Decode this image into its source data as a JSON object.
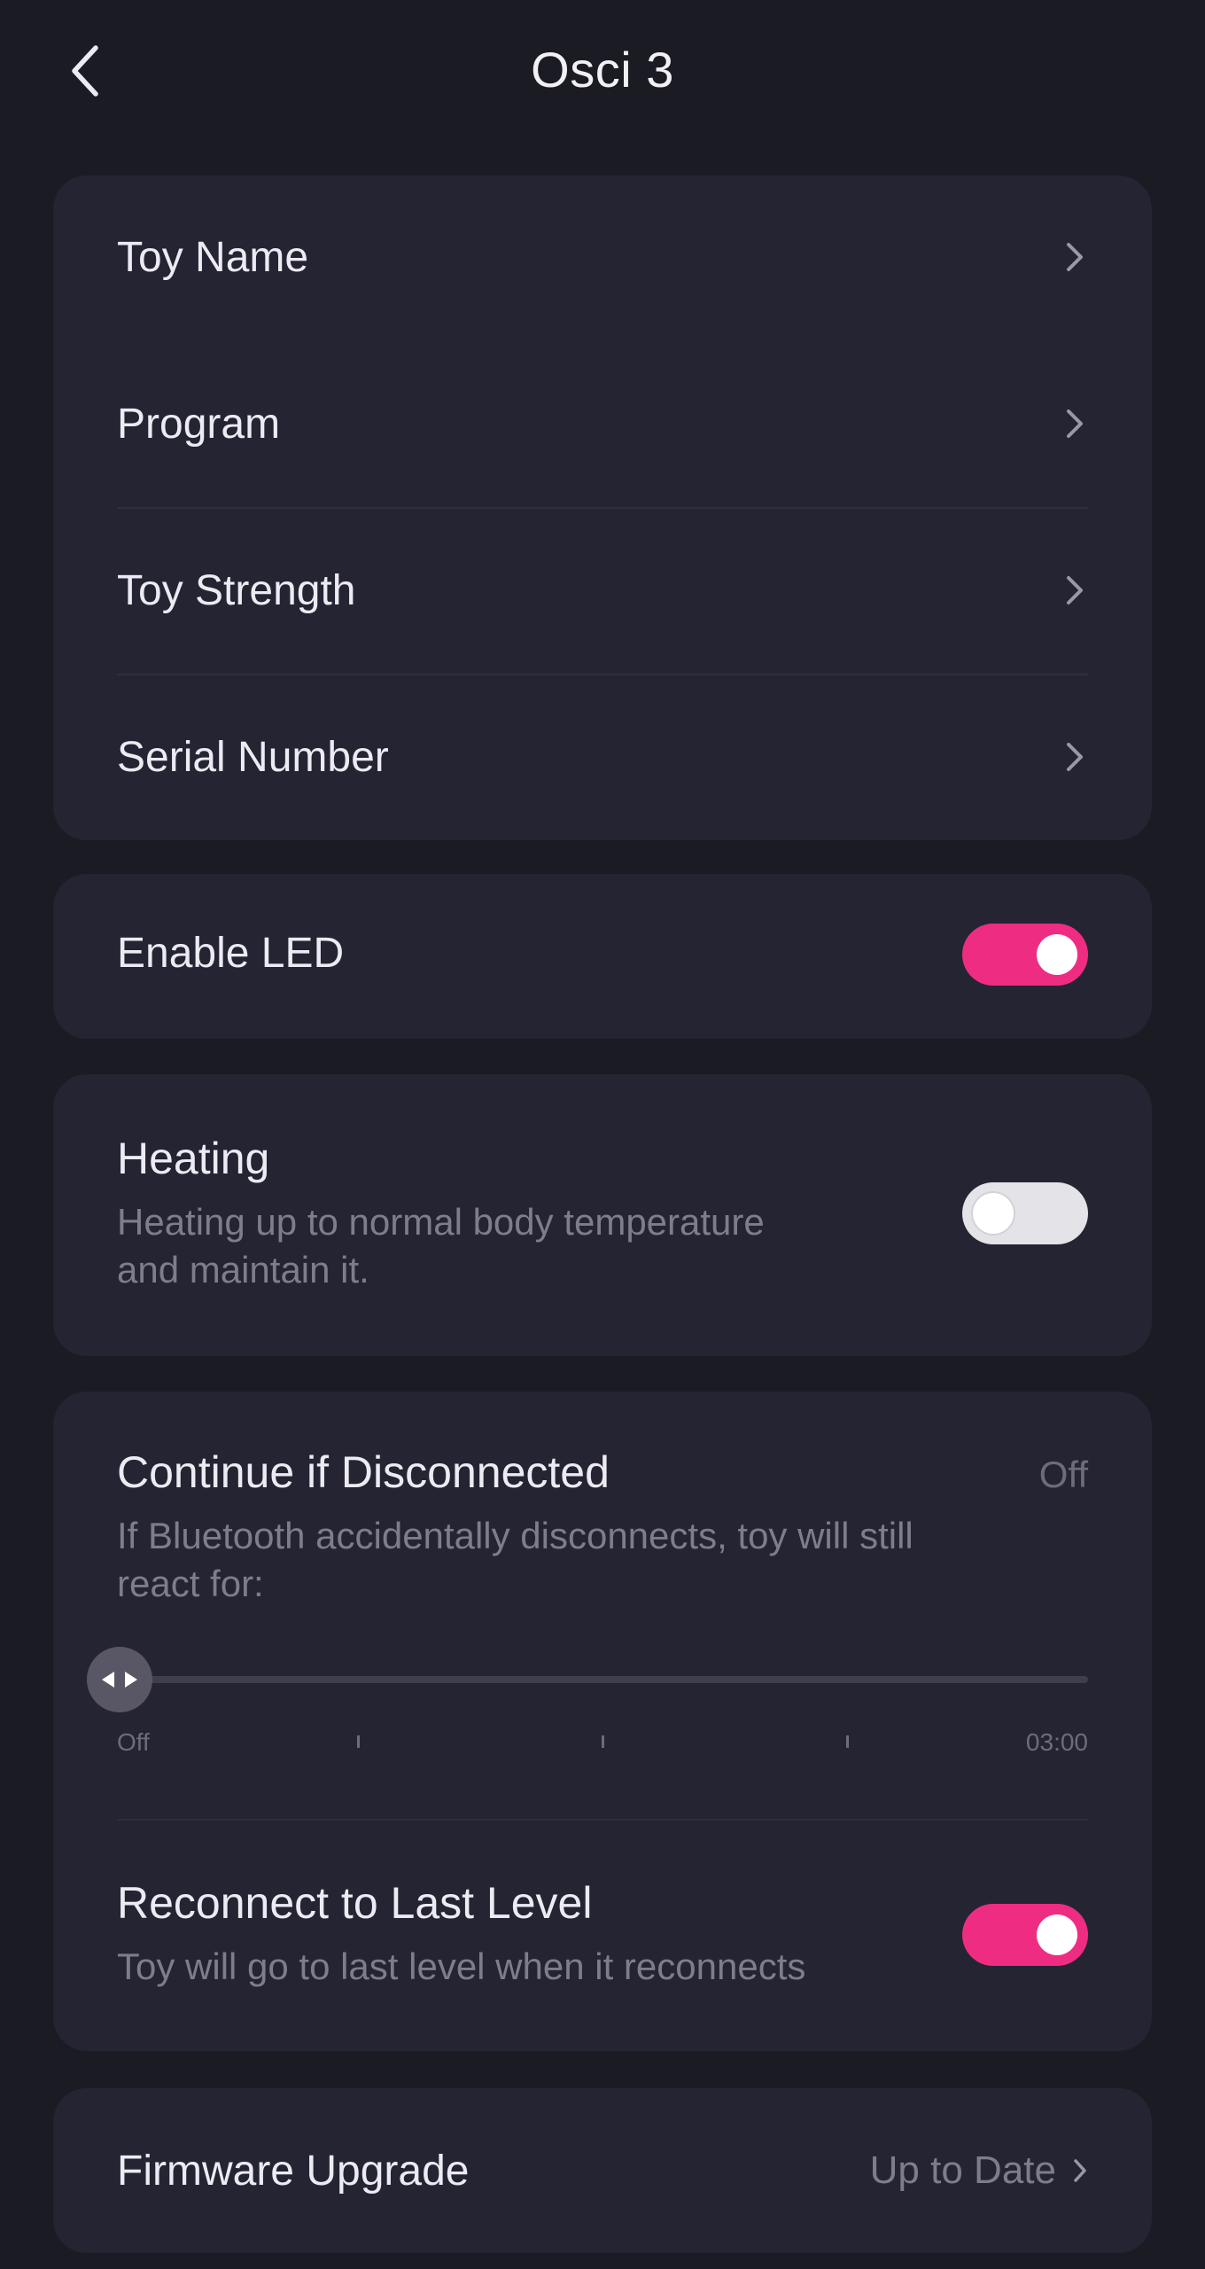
{
  "header": {
    "title": "Osci 3"
  },
  "device_menu": [
    {
      "label": "Toy Name"
    },
    {
      "label": "Program"
    },
    {
      "label": "Toy Strength"
    },
    {
      "label": "Serial Number"
    }
  ],
  "led": {
    "label": "Enable LED",
    "enabled": true
  },
  "heating": {
    "title": "Heating",
    "description_line1": "Heating up to normal body temperature",
    "description_line2": "and maintain it.",
    "enabled": false
  },
  "continue_disconnected": {
    "title": "Continue if Disconnected",
    "value": "Off",
    "description_line1": "If Bluetooth accidentally disconnects, toy will still",
    "description_line2": "react for:",
    "slider_value": 0,
    "slider_min_label": "Off",
    "slider_max_label": "03:00"
  },
  "reconnect": {
    "title": "Reconnect to Last Level",
    "description": "Toy will go to last level when it reconnects",
    "enabled": true
  },
  "firmware": {
    "label": "Firmware Upgrade",
    "status": "Up to Date"
  },
  "colors": {
    "accent": "#ee2d82",
    "background": "#1b1b24",
    "card": "#242432"
  }
}
